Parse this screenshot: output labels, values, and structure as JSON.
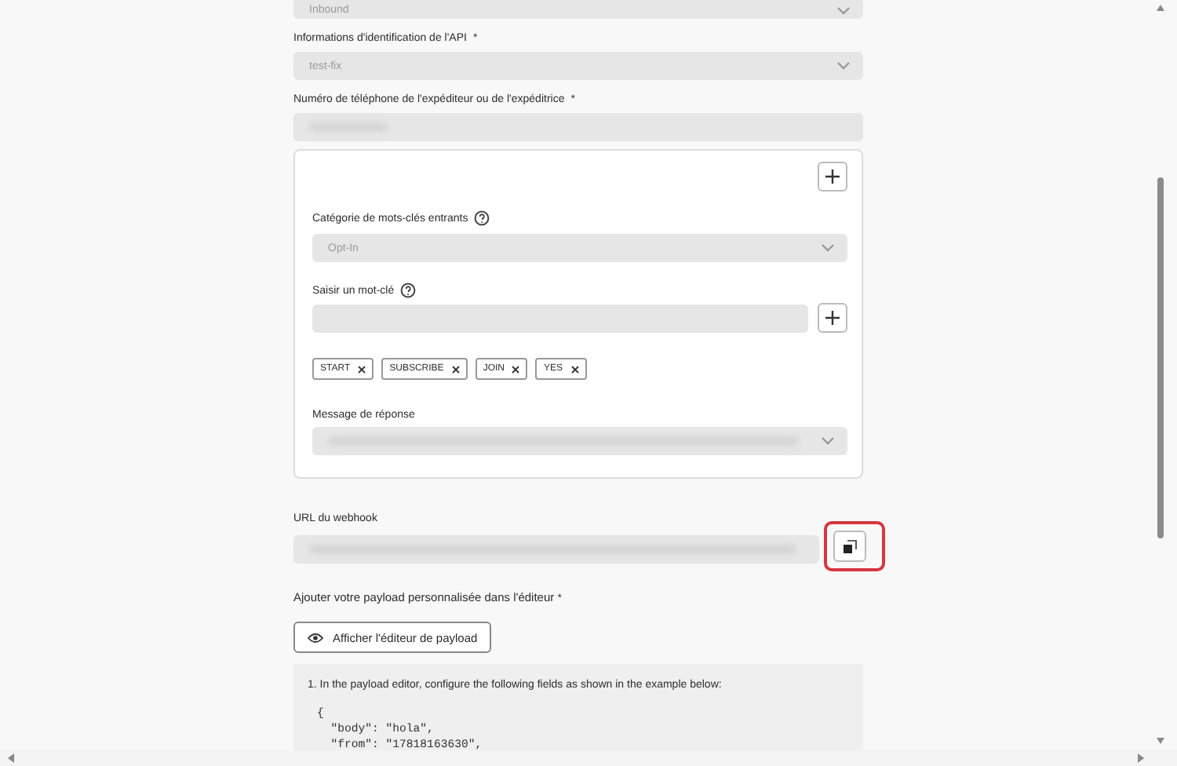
{
  "fields_top": [
    {
      "kind": "select",
      "value": "Inbound"
    },
    {
      "kind": "select",
      "label": "Informations d'identification de l'API",
      "value": "test-fix",
      "required_mark": "*"
    },
    {
      "kind": "redacted",
      "label": "Numéro de téléphone de l'expéditeur ou de l'expéditrice",
      "required_mark": "*"
    }
  ],
  "keyword_card": {
    "category": {
      "label": "Catégorie de mots-clés entrants",
      "value": "Opt-In"
    },
    "keyword_input": {
      "label": "Saisir un mot-clé"
    },
    "tags": [
      "START",
      "SUBSCRIBE",
      "JOIN",
      "YES"
    ],
    "reply": {
      "label": "Message de réponse"
    }
  },
  "webhook": {
    "label": "URL du webhook",
    "highlighted": true
  },
  "payload": {
    "label": "Ajouter votre payload personnalisée dans l'éditeur",
    "required_mark": "*",
    "button": "Afficher l'éditeur de payload",
    "instruction": "1. In the payload editor, configure the following fields as shown in the example below:",
    "code_lines": [
      "{",
      "  \"body\": \"hola\",",
      "  \"from\": \"17818163630\","
    ]
  }
}
